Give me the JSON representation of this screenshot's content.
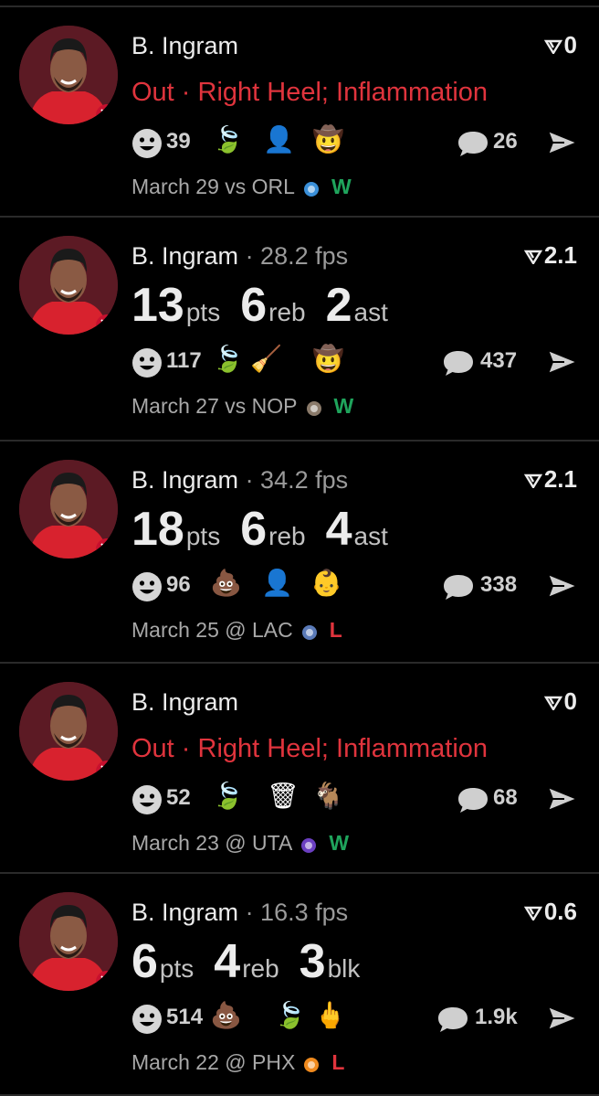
{
  "feed": [
    {
      "player": "B. Ingram",
      "fps": "",
      "score": "0",
      "status": "Out · Right Heel; Inflammation",
      "stats": [],
      "reactions": {
        "smile_count": "39",
        "emojis": [
          "🍃",
          "👤",
          "🤠"
        ],
        "comments": "26"
      },
      "game": {
        "date": "March 29",
        "sep": "vs",
        "opp": "ORL",
        "result": "W"
      }
    },
    {
      "player": "B. Ingram",
      "fps": "· 28.2 fps",
      "score": "2.1",
      "status": "",
      "stats": [
        {
          "num": "13",
          "unit": "pts"
        },
        {
          "num": "6",
          "unit": "reb"
        },
        {
          "num": "2",
          "unit": "ast"
        }
      ],
      "reactions": {
        "smile_count": "117",
        "emojis": [
          "🍃",
          "🧹",
          "🤠"
        ],
        "comments": "437"
      },
      "game": {
        "date": "March 27",
        "sep": "vs",
        "opp": "NOP",
        "result": "W"
      }
    },
    {
      "player": "B. Ingram",
      "fps": "· 34.2 fps",
      "score": "2.1",
      "status": "",
      "stats": [
        {
          "num": "18",
          "unit": "pts"
        },
        {
          "num": "6",
          "unit": "reb"
        },
        {
          "num": "4",
          "unit": "ast"
        }
      ],
      "reactions": {
        "smile_count": "96",
        "emojis": [
          "💩",
          "👤",
          "👶"
        ],
        "comments": "338"
      },
      "game": {
        "date": "March 25",
        "sep": "@",
        "opp": "LAC",
        "result": "L"
      }
    },
    {
      "player": "B. Ingram",
      "fps": "",
      "score": "0",
      "status": "Out · Right Heel; Inflammation",
      "stats": [],
      "reactions": {
        "smile_count": "52",
        "emojis": [
          "🍃",
          "🗑",
          "🐐"
        ],
        "comments": "68"
      },
      "game": {
        "date": "March 23",
        "sep": "@",
        "opp": "UTA",
        "result": "W"
      }
    },
    {
      "player": "B. Ingram",
      "fps": "· 16.3 fps",
      "score": "0.6",
      "status": "",
      "stats": [
        {
          "num": "6",
          "unit": "pts"
        },
        {
          "num": "4",
          "unit": "reb"
        },
        {
          "num": "3",
          "unit": "blk"
        }
      ],
      "reactions": {
        "smile_count": "514",
        "emojis": [
          "💩",
          "🍃",
          "🖕"
        ],
        "comments": "1.9k"
      },
      "game": {
        "date": "March 22",
        "sep": "@",
        "opp": "PHX",
        "result": "L"
      }
    }
  ],
  "colors": {
    "accent_red": "#e0343d",
    "win_green": "#1fa45c",
    "divider": "#2a2a2a"
  }
}
